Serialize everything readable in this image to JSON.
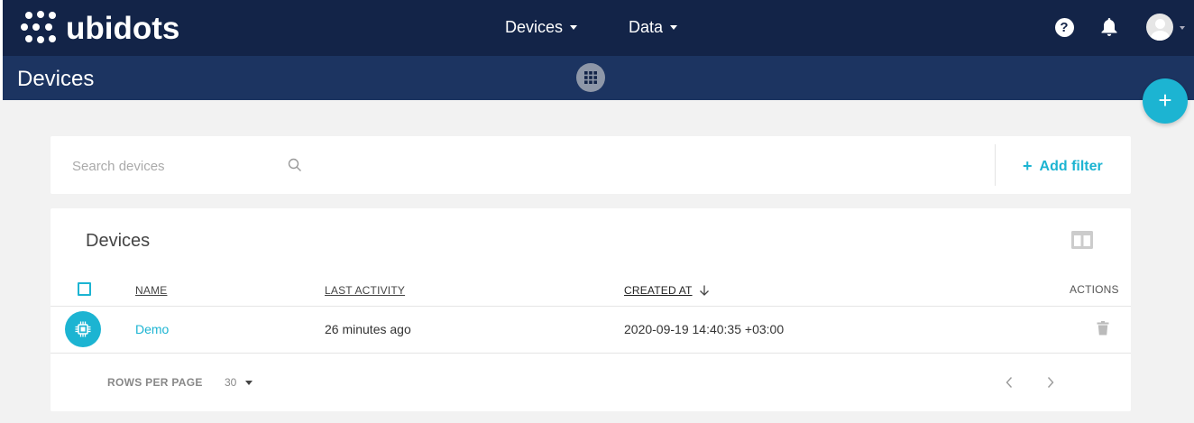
{
  "app": {
    "name": "ubidots"
  },
  "nav": {
    "devices_label": "Devices",
    "data_label": "Data"
  },
  "header": {
    "page_title": "Devices"
  },
  "search": {
    "placeholder": "Search devices",
    "value": "",
    "add_filter_label": "Add filter"
  },
  "table": {
    "title": "Devices",
    "columns": {
      "name": "NAME",
      "last_activity": "LAST ACTIVITY",
      "created_at": "CREATED AT",
      "actions": "ACTIONS"
    },
    "sort": {
      "column": "created_at",
      "direction": "descending"
    },
    "rows": [
      {
        "name": "Demo",
        "last_activity": "26 minutes ago",
        "created_at": "2020-09-19 14:40:35 +03:00"
      }
    ],
    "footer": {
      "rows_per_page_label": "ROWS PER PAGE",
      "rows_per_page_value": "30"
    }
  },
  "colors": {
    "navbar": "#132448",
    "subbar": "#1c3461",
    "accent": "#1cb4d2",
    "background": "#f2f2f2"
  },
  "icons": [
    "help-icon",
    "bell-icon",
    "avatar",
    "apps-grid-icon",
    "plus-icon",
    "search-icon",
    "columns-icon",
    "device-chip-icon",
    "trash-icon",
    "chevron-left-icon",
    "chevron-right-icon"
  ]
}
